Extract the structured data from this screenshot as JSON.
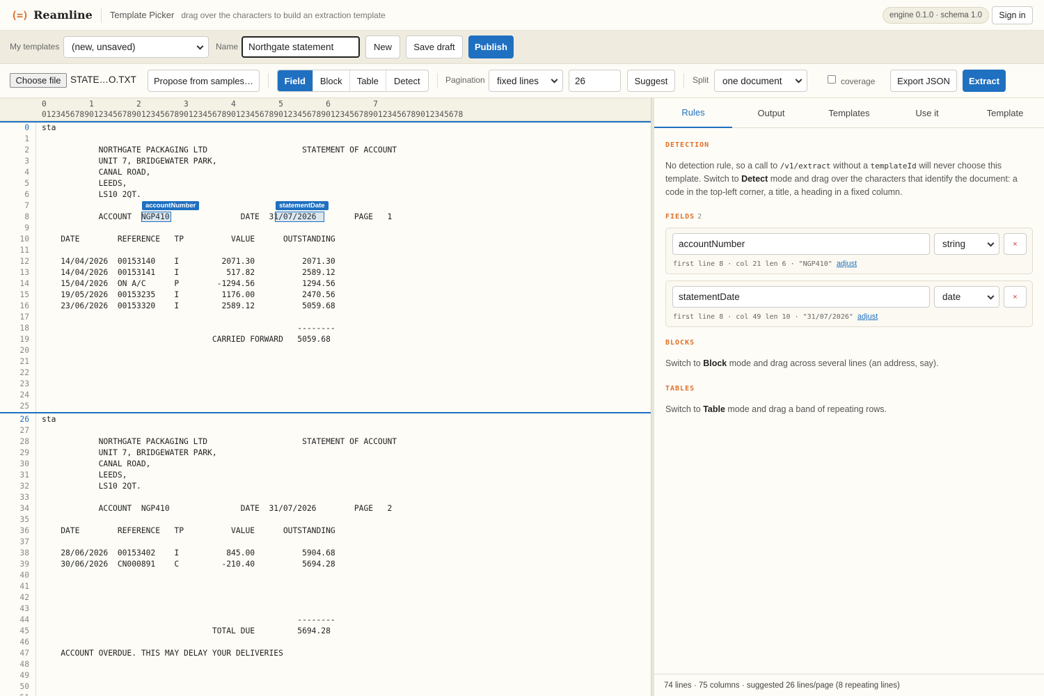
{
  "topbar": {
    "logo_mark": "(=)",
    "app_name": "Reamline",
    "title": "Template Picker",
    "hint": "drag over the characters to build an extraction template",
    "engine_badge": "engine 0.1.0 · schema 1.0",
    "sign_in": "Sign in"
  },
  "templates_bar": {
    "my_templates_label": "My templates",
    "my_templates_value": "(new, unsaved)",
    "name_label": "Name",
    "name_value": "Northgate statement",
    "new_label": "New",
    "save_draft_label": "Save draft",
    "publish_label": "Publish"
  },
  "toolbar": {
    "choose_file_label": "Choose file",
    "file_name": "STATE…O.TXT",
    "propose_label": "Propose from samples…",
    "modes": [
      "Field",
      "Block",
      "Table",
      "Detect"
    ],
    "active_mode": "Field",
    "pagination_label": "Pagination",
    "pagination_value": "fixed lines",
    "pagination_lines": "26",
    "suggest_label": "Suggest",
    "split_label": "Split",
    "split_value": "one document",
    "coverage_label": "coverage",
    "coverage_checked": false,
    "export_label": "Export JSON",
    "extract_label": "Extract"
  },
  "ruler": {
    "tens": "0         1         2         3         4         5         6         7",
    "units": "01234567890123456789012345678901234567890123456789012345678901234567890123456789012345678"
  },
  "document": {
    "page_start_lines": [
      0,
      26
    ],
    "lines": [
      "sta",
      "",
      "            NORTHGATE PACKAGING LTD                    STATEMENT OF ACCOUNT",
      "            UNIT 7, BRIDGEWATER PARK,",
      "            CANAL ROAD,",
      "            LEEDS,",
      "            LS10 2QT.",
      "",
      "            ACCOUNT  NGP410               DATE  31/07/2026        PAGE   1",
      "",
      "    DATE        REFERENCE   TP          VALUE      OUTSTANDING",
      "",
      "    14/04/2026  00153140    I         2071.30          2071.30",
      "    14/04/2026  00153141    I          517.82          2589.12",
      "    15/04/2026  ON A/C      P        -1294.56          1294.56",
      "    19/05/2026  00153235    I         1176.00          2470.56",
      "    23/06/2026  00153320    I         2589.12          5059.68",
      "",
      "                                                      --------",
      "                                    CARRIED FORWARD   5059.68",
      "",
      "",
      "",
      "",
      "",
      "",
      "sta",
      "",
      "            NORTHGATE PACKAGING LTD                    STATEMENT OF ACCOUNT",
      "            UNIT 7, BRIDGEWATER PARK,",
      "            CANAL ROAD,",
      "            LEEDS,",
      "            LS10 2QT.",
      "",
      "            ACCOUNT  NGP410               DATE  31/07/2026        PAGE   2",
      "",
      "    DATE        REFERENCE   TP          VALUE      OUTSTANDING",
      "",
      "    28/06/2026  00153402    I          845.00          5904.68",
      "    30/06/2026  CN000891    C         -210.40          5694.28",
      "",
      "",
      "",
      "",
      "                                                      --------",
      "                                    TOTAL DUE         5694.28",
      "",
      "    ACCOUNT OVERDUE. THIS MAY DELAY YOUR DELIVERIES",
      "",
      "",
      "",
      ""
    ],
    "selections": [
      {
        "field": "accountNumber",
        "line": 8,
        "col": 21,
        "len": 6
      },
      {
        "field": "statementDate",
        "line": 8,
        "col": 49,
        "len": 10
      }
    ]
  },
  "panel": {
    "tabs": [
      "Rules",
      "Output",
      "Templates",
      "Use it",
      "Template"
    ],
    "active_tab": "Rules",
    "detection": {
      "heading": "DETECTION",
      "text_1": "No detection rule, so a call to ",
      "code_1": "/v1/extract",
      "text_2": " without a ",
      "code_2": "templateId",
      "text_3": " will never choose this template. Switch to ",
      "bold_1": "Detect",
      "text_4": " mode and drag over the characters that identify the document: a code in the top-left corner, a title, a heading in a fixed column."
    },
    "fields": {
      "heading": "FIELDS",
      "count": "2",
      "items": [
        {
          "name": "accountNumber",
          "type": "string",
          "meta": "first line 8 · col 21 len 6 · \"NGP410\"",
          "adjust": "adjust",
          "remove": "×"
        },
        {
          "name": "statementDate",
          "type": "date",
          "meta": "first line 8 · col 49 len 10 · \"31/07/2026\"",
          "adjust": "adjust",
          "remove": "×"
        }
      ]
    },
    "blocks": {
      "heading": "BLOCKS",
      "text_1": "Switch to ",
      "bold": "Block",
      "text_2": " mode and drag across several lines (an address, say)."
    },
    "tables": {
      "heading": "TABLES",
      "text_1": "Switch to ",
      "bold": "Table",
      "text_2": " mode and drag a band of repeating rows."
    },
    "status": "74 lines · 75 columns · suggested 26 lines/page (8 repeating lines)"
  },
  "colors": {
    "accent": "#1f70c1",
    "brand_orange": "#e0702a",
    "background": "#fdfcf6"
  }
}
